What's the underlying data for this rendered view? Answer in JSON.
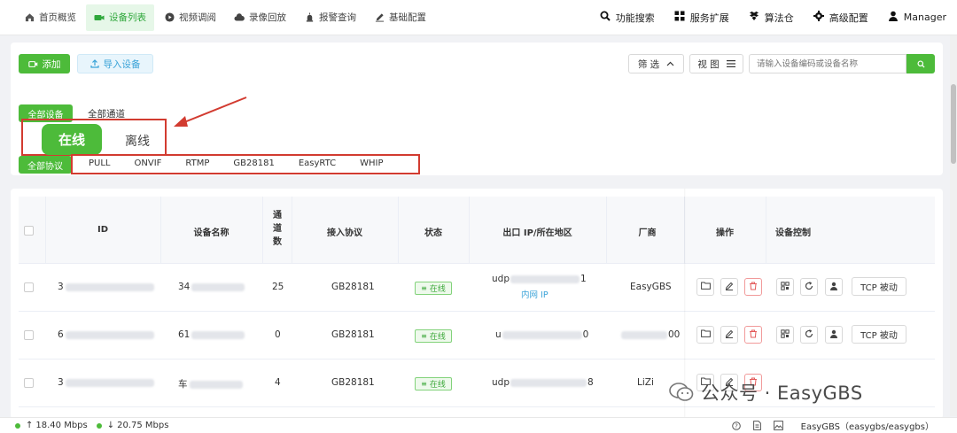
{
  "nav": {
    "items": [
      {
        "label": "首页概览",
        "icon": "home-icon"
      },
      {
        "label": "设备列表",
        "icon": "camera-icon",
        "active": true
      },
      {
        "label": "视频调阅",
        "icon": "play-icon"
      },
      {
        "label": "录像回放",
        "icon": "cloud-icon"
      },
      {
        "label": "报警查询",
        "icon": "alarm-icon"
      },
      {
        "label": "基础配置",
        "icon": "edit-icon"
      }
    ],
    "right": [
      {
        "label": "功能搜索",
        "icon": "search-icon"
      },
      {
        "label": "服务扩展",
        "icon": "grid-icon"
      },
      {
        "label": "算法仓",
        "icon": "box-icon"
      },
      {
        "label": "高级配置",
        "icon": "gear-icon"
      },
      {
        "label": "Manager",
        "icon": "user-icon"
      }
    ]
  },
  "toolbar": {
    "add_label": "添加",
    "import_label": "导入设备",
    "filter_label": "筛 选",
    "view_label": "视 图",
    "search_placeholder": "请输入设备编码或设备名称"
  },
  "tabs": {
    "all_devices": "全部设备",
    "all_channels": "全部通道",
    "online": "在线",
    "offline": "离线",
    "all_protocols": "全部协议",
    "protocols": [
      "PULL",
      "ONVIF",
      "RTMP",
      "GB28181",
      "EasyRTC",
      "WHIP"
    ]
  },
  "table": {
    "headers": {
      "id": "ID",
      "name": "设备名称",
      "channels": "通道数",
      "protocol": "接入协议",
      "status": "状态",
      "ip": "出口 IP/所在地区",
      "vendor": "厂商",
      "ops": "操作",
      "control": "设备控制"
    },
    "rows": [
      {
        "id_prefix": "3",
        "name_prefix": "34",
        "channels": "25",
        "protocol": "GB28181",
        "status": "在线",
        "ip_prefix": "udp",
        "ip_suffix": "1",
        "ip_sub": "内网 IP",
        "vendor": "EasyGBS",
        "tcp": "TCP 被动"
      },
      {
        "id_prefix": "6",
        "name_prefix": "61",
        "channels": "0",
        "protocol": "GB28181",
        "status": "在线",
        "ip_prefix": "u",
        "ip_suffix": "0",
        "ip_sub": "",
        "vendor": "",
        "vendor_suffix": "00",
        "tcp": "TCP 被动"
      },
      {
        "id_prefix": "3",
        "name_prefix": "车",
        "channels": "4",
        "protocol": "GB28181",
        "status": "在线",
        "ip_prefix": "udp",
        "ip_suffix": "8",
        "ip_sub": "",
        "vendor": "LiZi",
        "tcp": "TCP 被动"
      }
    ]
  },
  "status": {
    "up": "18.40 Mbps",
    "down": "20.75 Mbps",
    "server": "EasyGBS（easygbs/easygbs）"
  },
  "watermark": {
    "text": "公众号 · EasyGBS"
  },
  "colors": {
    "accent": "#4dbb3a",
    "annotation": "#d23b30"
  }
}
